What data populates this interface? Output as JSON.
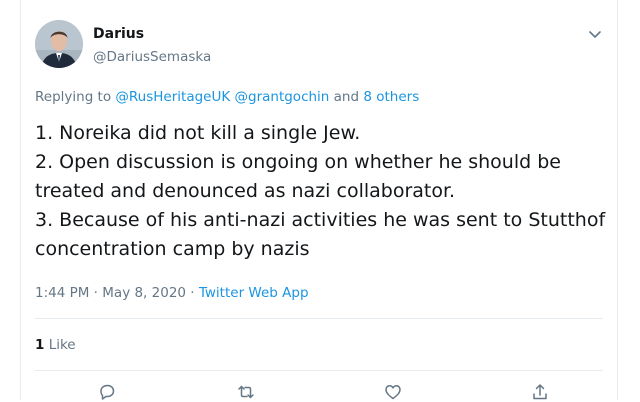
{
  "tweet": {
    "display_name": "Darius",
    "handle": "@DariusSemaska",
    "replying_prefix": "Replying to ",
    "replying_user_1": "@RusHeritageUK",
    "replying_user_2": "@grantgochin",
    "replying_and": " and ",
    "replying_others": "8 others",
    "lines": [
      "1. Noreika did not kill a single Jew.",
      "2. Open discussion is ongoing on whether he should be treated and denounced as nazi collaborator.",
      "3. Because of his anti-nazi activities he was sent to Stutthof concentration camp by nazis"
    ],
    "time": "1:44 PM · May 8, 2020",
    "meta_sep": " · ",
    "source": "Twitter Web App",
    "like_count": "1",
    "like_label": "Like"
  },
  "icons": {
    "menu": "chevron-down-icon",
    "reply": "reply-icon",
    "retweet": "retweet-icon",
    "like": "heart-icon",
    "share": "share-icon"
  },
  "colors": {
    "link": "#1b95e0",
    "secondary_text": "#657786",
    "primary_text": "#14171a",
    "border": "#e6ecf0"
  }
}
